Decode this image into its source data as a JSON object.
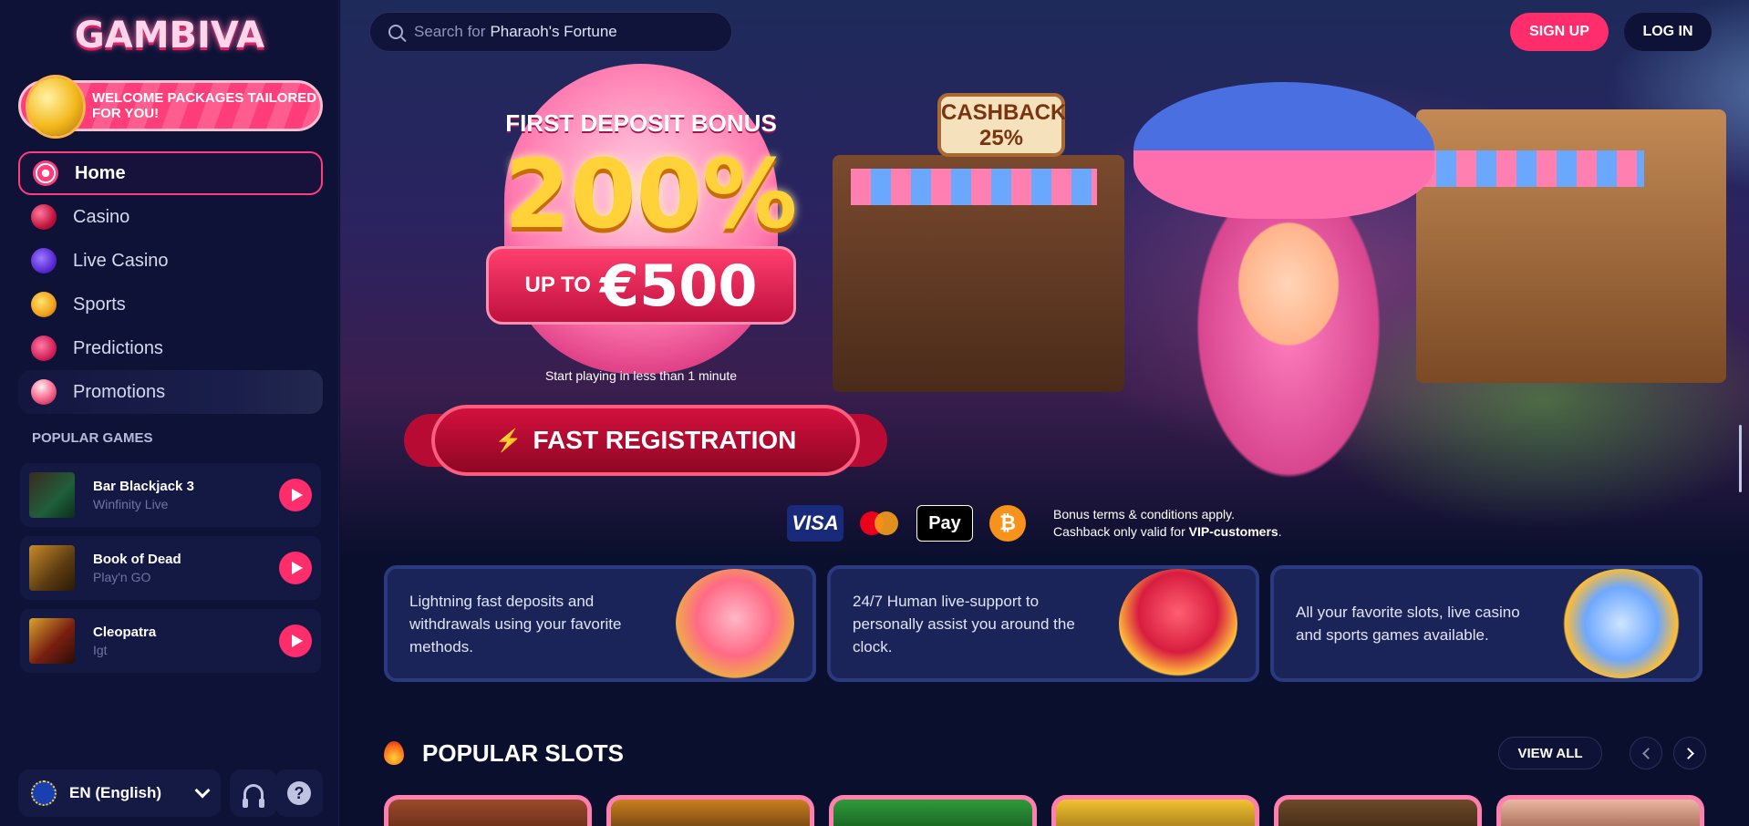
{
  "brand": {
    "logo_text": "GAMBIVA",
    "accent": "#ff2d6b"
  },
  "sidebar": {
    "welcome": "WELCOME PACKAGES TAILORED FOR YOU!",
    "nav": [
      {
        "label": "Home",
        "icon": "swirl-candy-icon",
        "active": true
      },
      {
        "label": "Casino",
        "icon": "cherry-icon"
      },
      {
        "label": "Live Casino",
        "icon": "purple-candy-icon"
      },
      {
        "label": "Sports",
        "icon": "medal-icon"
      },
      {
        "label": "Predictions",
        "icon": "chart-trend-icon"
      },
      {
        "label": "Promotions",
        "icon": "cupcake-icon"
      }
    ],
    "popular_label": "POPULAR GAMES",
    "games": [
      {
        "title": "Bar Blackjack 3",
        "provider": "Winfinity Live"
      },
      {
        "title": "Book of Dead",
        "provider": "Play'n GO"
      },
      {
        "title": "Cleopatra",
        "provider": "Igt"
      }
    ],
    "language": "EN (English)"
  },
  "header": {
    "search_prefix": "Search for",
    "search_value": "Pharaoh's Fortune",
    "signup": "SIGN UP",
    "login": "LOG IN"
  },
  "hero": {
    "heading": "FIRST DEPOSIT BONUS",
    "percent": "200%",
    "upto": "UP TO",
    "amount": "€500",
    "sub": "Start playing in less than 1 minute",
    "cta": "FAST REGISTRATION",
    "cashback_line1": "CASHBACK",
    "cashback_line2": "25%"
  },
  "payments": {
    "methods": [
      "VISA",
      "Mastercard",
      "Apple Pay",
      "Bitcoin"
    ],
    "visa": "VISA",
    "apple_pay": "Pay",
    "bitcoin": "₿",
    "note_line1": "Bonus terms & conditions apply.",
    "note_line2_prefix": "Cashback only valid for",
    "note_line2_bold": "VIP-customers",
    "note_line2_suffix": "."
  },
  "features": [
    {
      "text": "Lightning fast deposits and withdrawals using your favorite methods."
    },
    {
      "text": "24/7 Human live-support to personally assist you around the clock."
    },
    {
      "text": "All your favorite slots, live casino and sports games available."
    }
  ],
  "popular_slots": {
    "title": "POPULAR SLOTS",
    "view_all": "VIEW ALL"
  }
}
